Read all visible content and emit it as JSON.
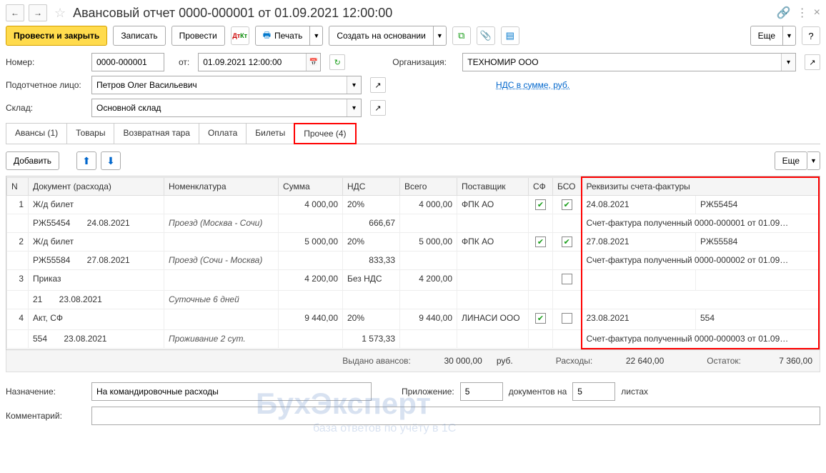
{
  "title": "Авансовый отчет 0000-000001 от 01.09.2021 12:00:00",
  "toolbar": {
    "post_close": "Провести и закрыть",
    "save": "Записать",
    "post": "Провести",
    "print": "Печать",
    "create_based": "Создать на основании",
    "more": "Еще"
  },
  "labels": {
    "number": "Номер:",
    "from": "от:",
    "org": "Организация:",
    "person": "Подотчетное лицо:",
    "warehouse": "Склад:",
    "nds_link": "НДС в сумме, руб.",
    "purpose": "Назначение:",
    "attachment": "Приложение:",
    "docs_on": "документов на",
    "sheets": "листах",
    "comment": "Комментарий:"
  },
  "header": {
    "number": "0000-000001",
    "date": "01.09.2021 12:00:00",
    "org": "ТЕХНОМИР ООО",
    "person": "Петров Олег Васильевич",
    "warehouse": "Основной склад"
  },
  "tabs": [
    "Авансы (1)",
    "Товары",
    "Возвратная тара",
    "Оплата",
    "Билеты",
    "Прочее (4)"
  ],
  "sub_toolbar": {
    "add": "Добавить",
    "more": "Еще"
  },
  "grid": {
    "headers": {
      "n": "N",
      "doc": "Документ (расхода)",
      "nomen": "Номенклатура",
      "sum": "Сумма",
      "nds": "НДС",
      "total": "Всего",
      "supplier": "Поставщик",
      "sf": "СФ",
      "bso": "БСО",
      "invoice": "Реквизиты счета-фактуры"
    },
    "rows": [
      {
        "n": "1",
        "doc_top": "Ж/д билет",
        "doc_num": "РЖ55454",
        "doc_date": "24.08.2021",
        "nomen": "Проезд (Москва - Сочи)",
        "sum": "4 000,00",
        "nds_rate": "20%",
        "nds_val": "666,67",
        "total": "4 000,00",
        "supplier": "ФПК АО",
        "sf": true,
        "bso": true,
        "inv_date": "24.08.2021",
        "inv_num": "РЖ55454",
        "inv_desc": "Счет-фактура полученный 0000-000001 от 01.09…"
      },
      {
        "n": "2",
        "doc_top": "Ж/д билет",
        "doc_num": "РЖ55584",
        "doc_date": "27.08.2021",
        "nomen": "Проезд (Сочи - Москва)",
        "sum": "5 000,00",
        "nds_rate": "20%",
        "nds_val": "833,33",
        "total": "5 000,00",
        "supplier": "ФПК АО",
        "sf": true,
        "bso": true,
        "inv_date": "27.08.2021",
        "inv_num": "РЖ55584",
        "inv_desc": "Счет-фактура полученный 0000-000002 от 01.09…"
      },
      {
        "n": "3",
        "doc_top": "Приказ",
        "doc_num": "21",
        "doc_date": "23.08.2021",
        "nomen": "Суточные 6 дней",
        "sum": "4 200,00",
        "nds_rate": "Без НДС",
        "nds_val": "",
        "total": "4 200,00",
        "supplier": "",
        "sf": null,
        "bso": false,
        "inv_date": "",
        "inv_num": "",
        "inv_desc": ""
      },
      {
        "n": "4",
        "doc_top": "Акт, СФ",
        "doc_num": "554",
        "doc_date": "23.08.2021",
        "nomen": "Проживание 2 сут.",
        "sum": "9 440,00",
        "nds_rate": "20%",
        "nds_val": "1 573,33",
        "total": "9 440,00",
        "supplier": "ЛИНАСИ ООО",
        "sf": true,
        "bso": false,
        "inv_date": "23.08.2021",
        "inv_num": "554",
        "inv_desc": "Счет-фактура полученный 0000-000003 от 01.09…"
      }
    ]
  },
  "totals": {
    "issued_lbl": "Выдано авансов:",
    "issued_val": "30 000,00",
    "cur": "руб.",
    "expenses_lbl": "Расходы:",
    "expenses_val": "22 640,00",
    "balance_lbl": "Остаток:",
    "balance_val": "7 360,00"
  },
  "footer": {
    "purpose": "На командировочные расходы",
    "att_docs": "5",
    "att_sheets": "5",
    "comment": ""
  },
  "watermark": "БухЭксперт",
  "watermark2": "база ответов по учёту в 1С"
}
